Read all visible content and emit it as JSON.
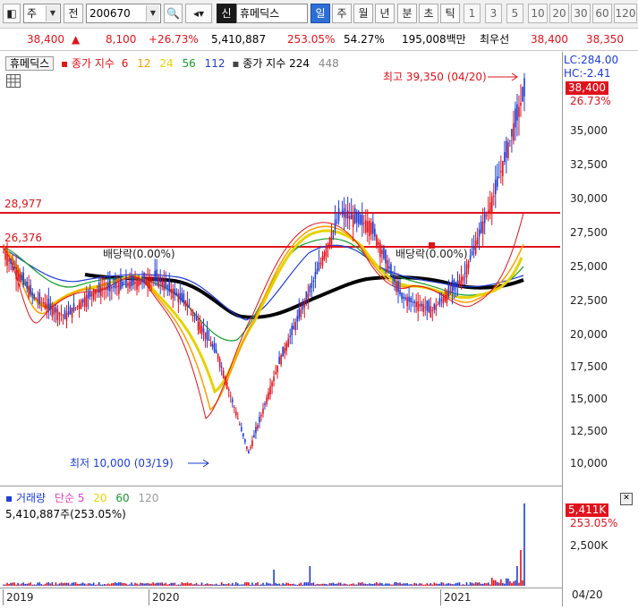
{
  "toolbar": {
    "market": "주",
    "prev_label": "전",
    "code": "200670",
    "new_badge": "신",
    "stock_name": "휴메딕스",
    "periods": [
      "일",
      "주",
      "월",
      "년",
      "분",
      "초",
      "틱"
    ],
    "active_period": "일",
    "intervals": [
      "1",
      "3",
      "5",
      "10",
      "20",
      "30",
      "60",
      "120"
    ]
  },
  "info": {
    "price": "38,400",
    "change": "8,100",
    "change_pct": "+26.73%",
    "volume": "5,410,887",
    "vol_ratio": "253.05%",
    "turnover": "54.27%",
    "amount": "195,008백만",
    "bid_label": "최우선",
    "bid1": "38,400",
    "bid2": "38,350"
  },
  "legend": {
    "name": "휴메딕스",
    "ma_label": "종가 지수",
    "ma_periods": [
      {
        "period": "6",
        "color": "#e0131c"
      },
      {
        "period": "12",
        "color": "#ff9c00"
      },
      {
        "period": "24",
        "color": "#e6d200"
      },
      {
        "period": "56",
        "color": "#169b2c"
      },
      {
        "period": "112",
        "color": "#1e3cd6"
      }
    ],
    "ma_label2": "종가 지수 224",
    "ma_extra": "448"
  },
  "axis_info": {
    "lc": "LC:284.00",
    "hc": "HC:-2.41",
    "current_price": "38,400",
    "current_pct": "26.73%"
  },
  "price_ticks": [
    "35,000",
    "32,500",
    "30,000",
    "27,500",
    "25,000",
    "22,500",
    "20,000",
    "17,500",
    "15,000",
    "12,500",
    "10,000"
  ],
  "hlines": {
    "upper": "28,977",
    "lower": "26,376"
  },
  "annotations": {
    "high": "최고 39,350 (04/20)",
    "low": "최저 10,000 (03/19)",
    "dividend1": "배당락(0.00%)",
    "dividend2": "배당락(0.00%)"
  },
  "volume": {
    "legend_title": "거래량",
    "legend_simple": "단순 5",
    "ma": [
      {
        "period": "20",
        "color": "#e6d200"
      },
      {
        "period": "60",
        "color": "#169b2c"
      },
      {
        "period": "120",
        "color": "#9a9a9a"
      }
    ],
    "info": "5,410,887주(253.05%)",
    "current": "5,411K",
    "current_pct": "253.05%",
    "tick": "2,500K"
  },
  "dates": [
    "2019",
    "2020",
    "2021"
  ],
  "date_end": "04/20",
  "chart_data": {
    "type": "line",
    "title": "",
    "xlabel": "",
    "ylabel": "",
    "ylim": [
      9000,
      39500
    ],
    "x": [
      "2019-01",
      "2019-03",
      "2019-05",
      "2019-07",
      "2019-09",
      "2019-11",
      "2020-01",
      "2020-02",
      "2020-03",
      "2020-04",
      "2020-05",
      "2020-07",
      "2020-09",
      "2020-11",
      "2021-01",
      "2021-03",
      "2021-04-19",
      "2021-04-20"
    ],
    "series": [
      {
        "name": "종가",
        "values": [
          26000,
          22500,
          21000,
          23000,
          23500,
          24000,
          22000,
          18000,
          10500,
          17500,
          23000,
          29000,
          28000,
          22500,
          21500,
          24000,
          30300,
          38400
        ]
      }
    ]
  }
}
